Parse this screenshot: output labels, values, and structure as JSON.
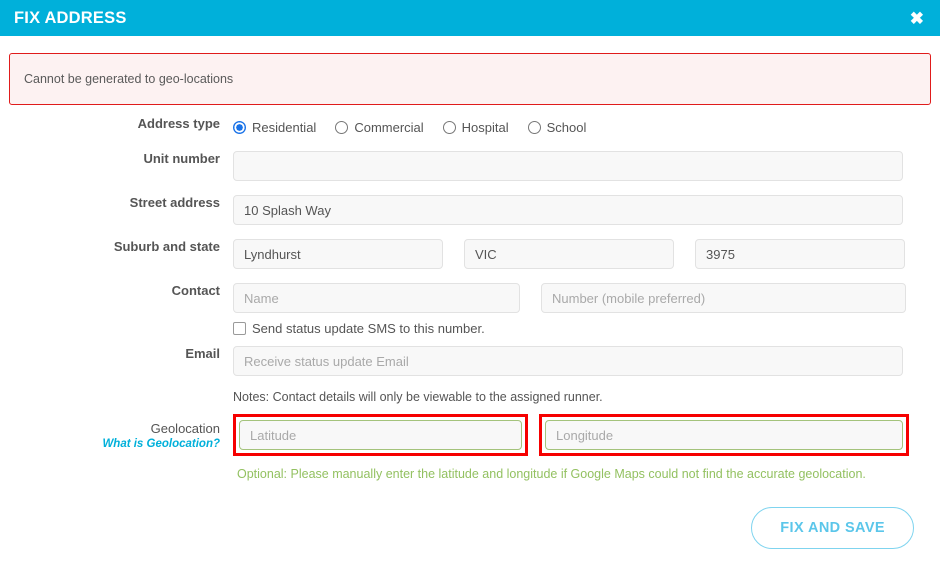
{
  "header": {
    "title": "FIX ADDRESS",
    "close_icon": "close-icon",
    "close_glyph": "✖",
    "background_color": "#00b0da"
  },
  "alert": {
    "message": "Cannot be generated to geo-locations",
    "border_color": "#e01b1b",
    "background_color": "#fdf2f2"
  },
  "form": {
    "address_type": {
      "label": "Address type",
      "options": [
        {
          "label": "Residential",
          "selected": true
        },
        {
          "label": "Commercial",
          "selected": false
        },
        {
          "label": "Hospital",
          "selected": false
        },
        {
          "label": "School",
          "selected": false
        }
      ],
      "selected_color": "#1a73e8"
    },
    "unit_number": {
      "label": "Unit number",
      "value": "",
      "placeholder": ""
    },
    "street_address": {
      "label": "Street address",
      "value": "10 Splash Way",
      "placeholder": ""
    },
    "suburb_and_state": {
      "label": "Suburb and state",
      "suburb_value": "Lyndhurst",
      "suburb_placeholder": "",
      "state_value": "VIC",
      "state_placeholder": "",
      "postcode_value": "3975",
      "postcode_placeholder": ""
    },
    "contact": {
      "label": "Contact",
      "name_value": "",
      "name_placeholder": "Name",
      "number_value": "",
      "number_placeholder": "Number (mobile preferred)",
      "sms_checkbox_label": "Send status update SMS to this number.",
      "sms_checked": false
    },
    "email": {
      "label": "Email",
      "value": "",
      "placeholder": "Receive status update Email",
      "note": "Notes: Contact details will only be viewable to the assigned runner."
    },
    "geolocation": {
      "label": "Geolocation",
      "help_link": "What is Geolocation?",
      "latitude_value": "",
      "latitude_placeholder": "Latitude",
      "longitude_value": "",
      "longitude_placeholder": "Longitude",
      "hint": "Optional: Please manually enter the latitude and longitude if Google Maps could not find the accurate geolocation.",
      "hint_color": "#93c161",
      "highlight_color": "#f60000",
      "input_border_color": "#a4c37c"
    }
  },
  "footer": {
    "submit_label": "FIX AND SAVE",
    "submit_border_color": "#7fd4ef",
    "submit_text_color": "#5bc6ea"
  }
}
